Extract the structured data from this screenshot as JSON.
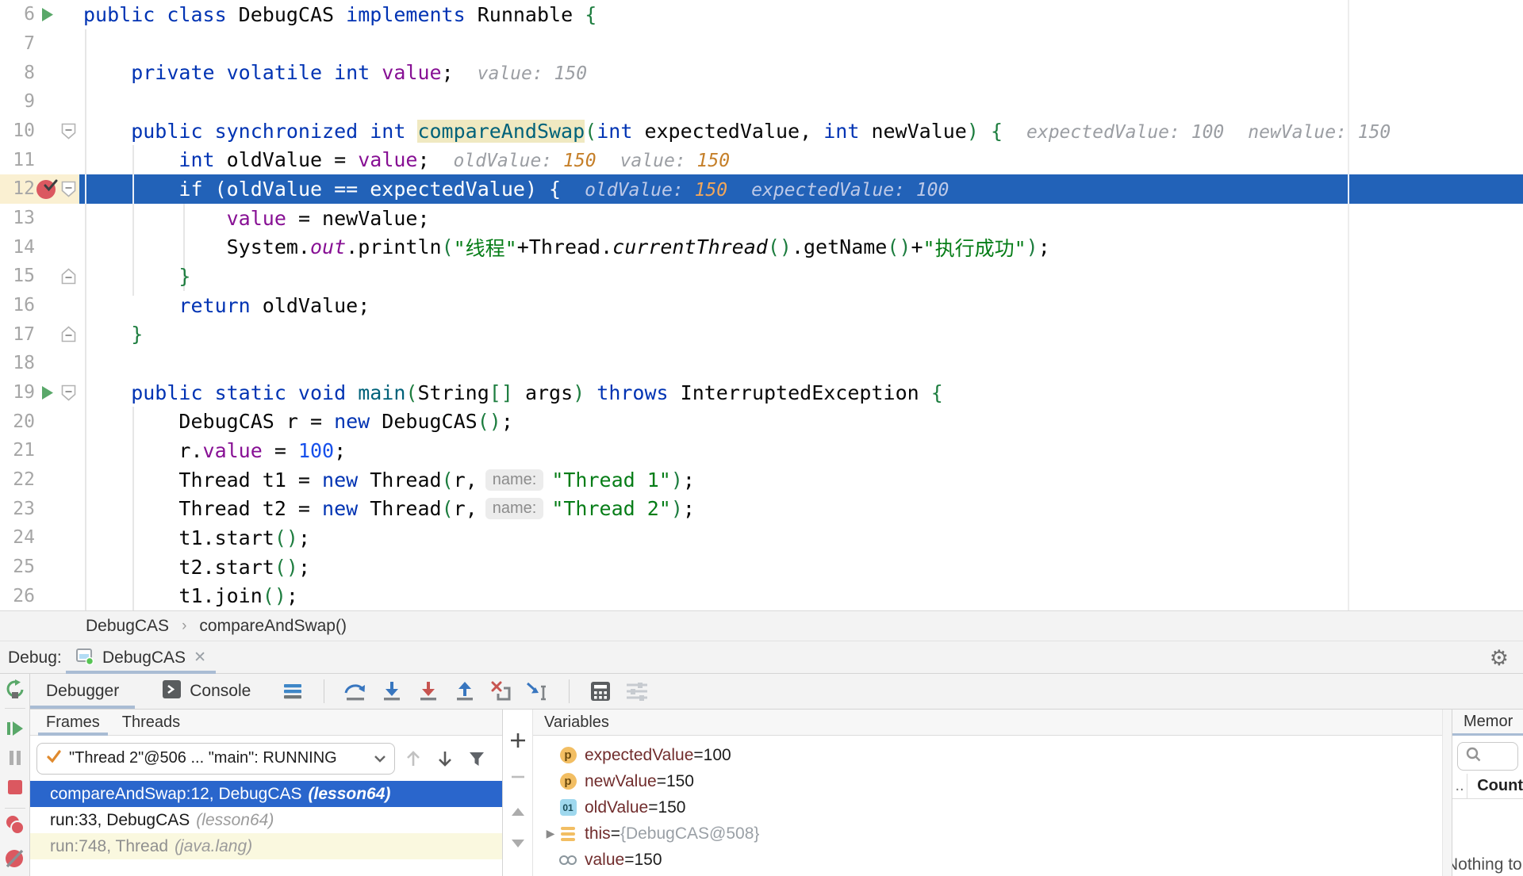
{
  "colors": {
    "exec_line_bg": "#2262B8",
    "frame_selected_bg": "#2A66CC",
    "breakpoint_red": "#DB5860",
    "run_green": "#59A869",
    "tab_underline": "#A9BCD4",
    "identifier_highlight": "#F0E9C1",
    "library_frame_bg": "#FAF8DF",
    "hint_orange": "#C57F29"
  },
  "editor": {
    "margin_guide_x": 1699,
    "lines": [
      {
        "n": 6,
        "g": "run",
        "tok": [
          [
            "k",
            "public class "
          ],
          [
            "d",
            "DebugCAS "
          ],
          [
            "k",
            "implements "
          ],
          [
            "d",
            "Runnable "
          ],
          [
            "p",
            "{"
          ]
        ]
      },
      {
        "n": 7,
        "tok": []
      },
      {
        "n": 8,
        "tok": [
          [
            "k",
            "    private volatile int "
          ],
          [
            "f",
            "value"
          ],
          [
            "d",
            ";"
          ]
        ],
        "hints": [
          [
            [
              "h",
              "value: 150"
            ]
          ]
        ]
      },
      {
        "n": 9,
        "tok": []
      },
      {
        "n": 10,
        "fold": "down",
        "tok": [
          [
            "k",
            "    public synchronized int "
          ],
          [
            "hl",
            "compareAndSwap"
          ],
          [
            "p",
            "("
          ],
          [
            "k",
            "int "
          ],
          [
            "d",
            "expectedValue, "
          ],
          [
            "k",
            "int "
          ],
          [
            "d",
            "newValue"
          ],
          [
            "p",
            ") {"
          ]
        ],
        "hints": [
          [
            [
              "h",
              "expectedValue: 100"
            ]
          ],
          [
            [
              "h",
              "newValue: 150"
            ]
          ]
        ]
      },
      {
        "n": 11,
        "tok": [
          [
            "d",
            "        "
          ],
          [
            "k",
            "int "
          ],
          [
            "d",
            "oldValue = "
          ],
          [
            "f",
            "value"
          ],
          [
            "d",
            ";"
          ]
        ],
        "hints": [
          [
            [
              "h",
              "oldValue: "
            ],
            [
              "o",
              "150"
            ]
          ],
          [
            [
              "h",
              "value: "
            ],
            [
              "o",
              "150"
            ]
          ]
        ]
      },
      {
        "n": 12,
        "g": "bp",
        "fold": "down",
        "exec": true,
        "tok": [
          [
            "k",
            "        if "
          ],
          [
            "p",
            "("
          ],
          [
            "d",
            "oldValue == expectedValue"
          ],
          [
            "p",
            ") {"
          ]
        ],
        "hints": [
          [
            [
              "h",
              "oldValue: "
            ],
            [
              "o",
              "150"
            ]
          ],
          [
            [
              "h",
              "expectedValue: 100"
            ]
          ]
        ]
      },
      {
        "n": 13,
        "tok": [
          [
            "d",
            "            "
          ],
          [
            "f",
            "value"
          ],
          [
            "d",
            " = newValue;"
          ]
        ]
      },
      {
        "n": 14,
        "tok": [
          [
            "d",
            "            System."
          ],
          [
            "sf",
            "out"
          ],
          [
            "d",
            ".println"
          ],
          [
            "p",
            "("
          ],
          [
            "s",
            "\"线程\""
          ],
          [
            "d",
            "+Thread."
          ],
          [
            "sm",
            "currentThread"
          ],
          [
            "p",
            "()"
          ],
          [
            "d",
            ".getName"
          ],
          [
            "p",
            "()"
          ],
          [
            "d",
            "+"
          ],
          [
            "s",
            "\"执行成功\""
          ],
          [
            "p",
            ")"
          ],
          [
            "d",
            ";"
          ]
        ]
      },
      {
        "n": 15,
        "fold": "up",
        "tok": [
          [
            "d",
            "        "
          ],
          [
            "p",
            "}"
          ]
        ]
      },
      {
        "n": 16,
        "tok": [
          [
            "d",
            "        "
          ],
          [
            "k",
            "return "
          ],
          [
            "d",
            "oldValue;"
          ]
        ]
      },
      {
        "n": 17,
        "fold": "up",
        "tok": [
          [
            "d",
            "    "
          ],
          [
            "p",
            "}"
          ]
        ]
      },
      {
        "n": 18,
        "tok": []
      },
      {
        "n": 19,
        "g": "run",
        "fold": "down",
        "tok": [
          [
            "k",
            "    public static void "
          ],
          [
            "m",
            "main"
          ],
          [
            "p",
            "("
          ],
          [
            "d",
            "String"
          ],
          [
            "p",
            "[]"
          ],
          [
            "d",
            " args"
          ],
          [
            "p",
            ")"
          ],
          [
            "k",
            " throws "
          ],
          [
            "d",
            "InterruptedException "
          ],
          [
            "p",
            "{"
          ]
        ]
      },
      {
        "n": 20,
        "tok": [
          [
            "d",
            "        DebugCAS r = "
          ],
          [
            "k",
            "new "
          ],
          [
            "d",
            "DebugCAS"
          ],
          [
            "p",
            "()"
          ],
          [
            "d",
            ";"
          ]
        ]
      },
      {
        "n": 21,
        "tok": [
          [
            "d",
            "        r."
          ],
          [
            "f",
            "value"
          ],
          [
            "d",
            " = "
          ],
          [
            "n",
            "100"
          ],
          [
            "d",
            ";"
          ]
        ]
      },
      {
        "n": 22,
        "tok": [
          [
            "d",
            "        Thread t1 = "
          ],
          [
            "k",
            "new "
          ],
          [
            "d",
            "Thread"
          ],
          [
            "p",
            "("
          ],
          [
            "d",
            "r,"
          ],
          [
            "pl",
            "name:"
          ],
          [
            "s",
            "\"Thread 1\""
          ],
          [
            "p",
            ")"
          ],
          [
            "d",
            ";"
          ]
        ]
      },
      {
        "n": 23,
        "tok": [
          [
            "d",
            "        Thread t2 = "
          ],
          [
            "k",
            "new "
          ],
          [
            "d",
            "Thread"
          ],
          [
            "p",
            "("
          ],
          [
            "d",
            "r,"
          ],
          [
            "pl",
            "name:"
          ],
          [
            "s",
            "\"Thread 2\""
          ],
          [
            "p",
            ")"
          ],
          [
            "d",
            ";"
          ]
        ]
      },
      {
        "n": 24,
        "tok": [
          [
            "d",
            "        t1.start"
          ],
          [
            "p",
            "()"
          ],
          [
            "d",
            ";"
          ]
        ]
      },
      {
        "n": 25,
        "tok": [
          [
            "d",
            "        t2.start"
          ],
          [
            "p",
            "()"
          ],
          [
            "d",
            ";"
          ]
        ]
      },
      {
        "n": 26,
        "tok": [
          [
            "d",
            "        t1.join"
          ],
          [
            "p",
            "()"
          ],
          [
            "d",
            ";"
          ]
        ]
      }
    ]
  },
  "breadcrumb": {
    "items": [
      "DebugCAS",
      "compareAndSwap()"
    ],
    "separator": "›"
  },
  "debug_header": {
    "label": "Debug:",
    "tab_title": "DebugCAS",
    "close_glyph": "✕",
    "gear_glyph": "⚙"
  },
  "toolbar": {
    "tabs": [
      {
        "label": "Debugger",
        "selected": true
      },
      {
        "label": "Console",
        "selected": false
      }
    ],
    "step_buttons": [
      "layout-menu",
      "step-over",
      "step-into",
      "force-step-into",
      "step-out",
      "drop-frame",
      "run-to-cursor",
      "evaluate-expression",
      "layout-settings"
    ]
  },
  "rail_buttons": [
    "rerun",
    "resume",
    "pause",
    "stop",
    "view-breakpoints",
    "mute-breakpoints"
  ],
  "frames": {
    "tabs": [
      {
        "label": "Frames",
        "selected": true
      },
      {
        "label": "Threads",
        "selected": false
      }
    ],
    "thread_dropdown": "\"Thread 2\"@506 ... \"main\": RUNNING",
    "rows": [
      {
        "text": "compareAndSwap:12, DebugCAS",
        "loc": "(lesson64)",
        "state": "selected"
      },
      {
        "text": "run:33, DebugCAS",
        "loc": "(lesson64)",
        "state": "normal"
      },
      {
        "text": "run:748, Thread",
        "loc": "(java.lang)",
        "state": "library"
      }
    ]
  },
  "variables": {
    "title": "Variables",
    "items": [
      {
        "icon": "param",
        "name": "expectedValue",
        "value": "100",
        "value_color": "dark",
        "expandable": false
      },
      {
        "icon": "param",
        "name": "newValue",
        "value": "150",
        "value_color": "dark",
        "expandable": false
      },
      {
        "icon": "local",
        "name": "oldValue",
        "value": "150",
        "value_color": "dark",
        "expandable": false
      },
      {
        "icon": "this",
        "name": "this",
        "value": "{DebugCAS@508}",
        "value_color": "gray",
        "expandable": true
      },
      {
        "icon": "watch",
        "name": "value",
        "value": "150",
        "value_color": "dark",
        "expandable": false
      }
    ]
  },
  "memory": {
    "title": "Memor",
    "columns": [
      "..",
      "Count"
    ],
    "empty_text": "Nothing to",
    "search_value": ""
  }
}
